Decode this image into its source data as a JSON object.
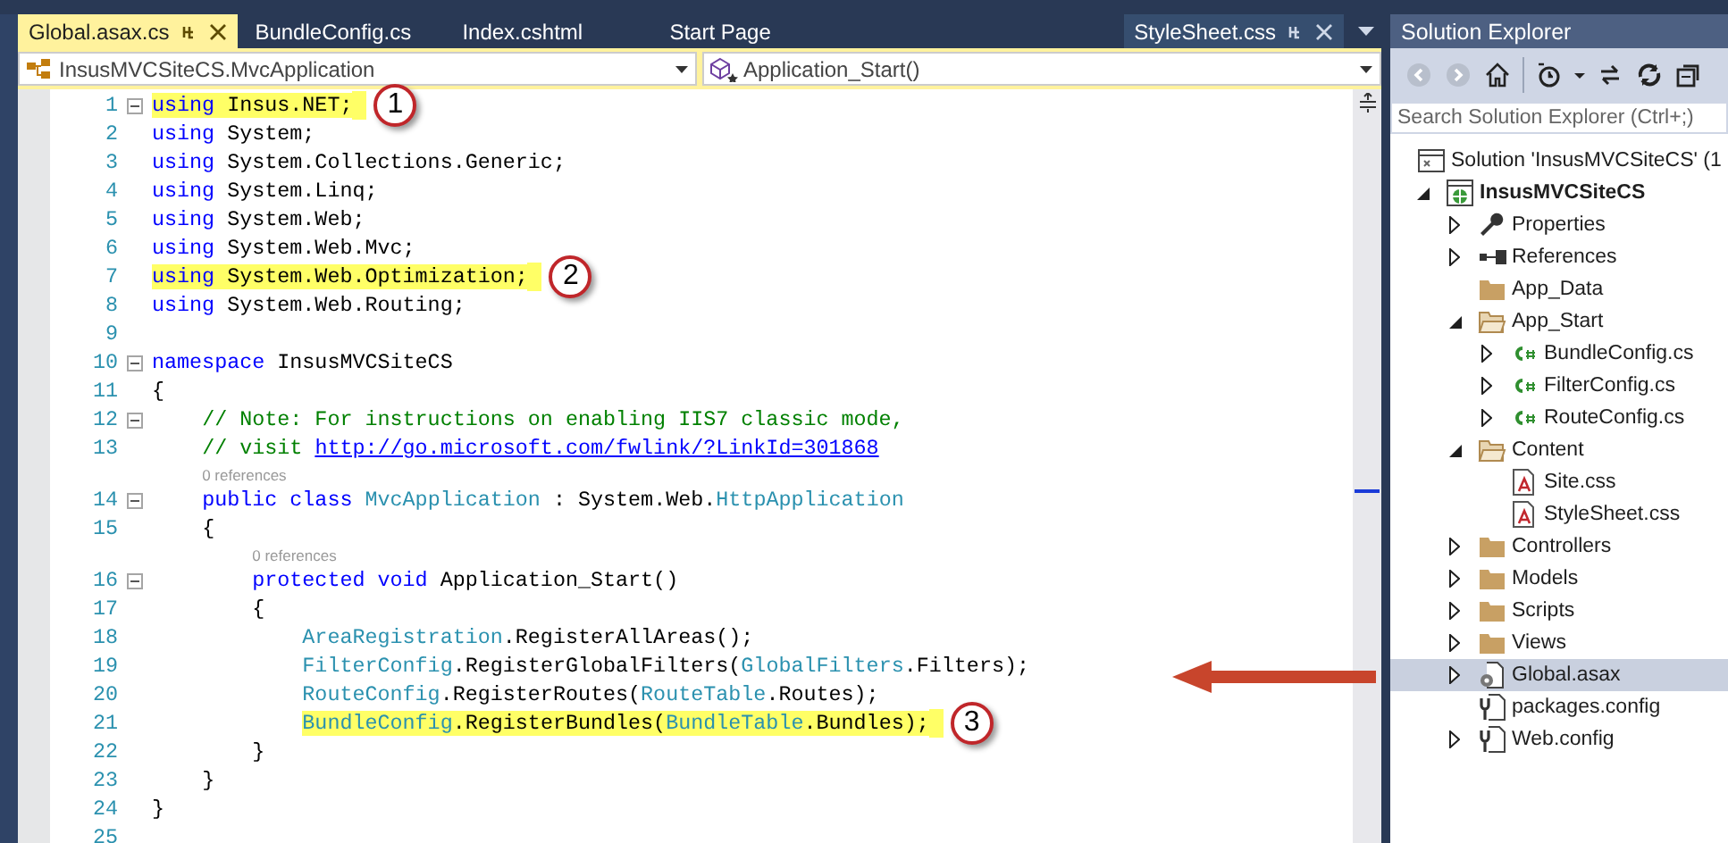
{
  "tabs": [
    {
      "label": "Global.asax.cs",
      "selected": true,
      "kind": "document"
    },
    {
      "label": "BundleConfig.cs",
      "selected": false,
      "kind": "document"
    },
    {
      "label": "Index.cshtml",
      "selected": false,
      "kind": "document"
    },
    {
      "label": "Start Page",
      "selected": false,
      "kind": "document"
    },
    {
      "label": "StyleSheet.css",
      "selected": false,
      "kind": "preview"
    }
  ],
  "navigation_bar": {
    "type_selector": "InsusMVCSiteCS.MvcApplication",
    "member_selector": "Application_Start()"
  },
  "code": {
    "lines": [
      {
        "kind": "code",
        "number": "1",
        "fold": true,
        "highlight": true,
        "callout": "1",
        "tokens": [
          {
            "kind": "kw",
            "text": "using"
          },
          {
            "kind": "plain",
            "text": " Insus.NET;"
          }
        ]
      },
      {
        "kind": "code",
        "number": "2",
        "fold": false,
        "highlight": false,
        "tokens": [
          {
            "kind": "kw",
            "text": "using"
          },
          {
            "kind": "plain",
            "text": " System;"
          }
        ]
      },
      {
        "kind": "code",
        "number": "3",
        "fold": false,
        "highlight": false,
        "tokens": [
          {
            "kind": "kw",
            "text": "using"
          },
          {
            "kind": "plain",
            "text": " System.Collections.Generic;"
          }
        ]
      },
      {
        "kind": "code",
        "number": "4",
        "fold": false,
        "highlight": false,
        "tokens": [
          {
            "kind": "kw",
            "text": "using"
          },
          {
            "kind": "plain",
            "text": " System.Linq;"
          }
        ]
      },
      {
        "kind": "code",
        "number": "5",
        "fold": false,
        "highlight": false,
        "tokens": [
          {
            "kind": "kw",
            "text": "using"
          },
          {
            "kind": "plain",
            "text": " System.Web;"
          }
        ]
      },
      {
        "kind": "code",
        "number": "6",
        "fold": false,
        "highlight": false,
        "tokens": [
          {
            "kind": "kw",
            "text": "using"
          },
          {
            "kind": "plain",
            "text": " System.Web.Mvc;"
          }
        ]
      },
      {
        "kind": "code",
        "number": "7",
        "fold": false,
        "highlight": true,
        "callout": "2",
        "tokens": [
          {
            "kind": "kw",
            "text": "using"
          },
          {
            "kind": "plain",
            "text": " System.Web.Optimization;"
          }
        ]
      },
      {
        "kind": "code",
        "number": "8",
        "fold": false,
        "highlight": false,
        "tokens": [
          {
            "kind": "kw",
            "text": "using"
          },
          {
            "kind": "plain",
            "text": " System.Web.Routing;"
          }
        ]
      },
      {
        "kind": "code",
        "number": "9",
        "fold": false
      },
      {
        "kind": "code",
        "number": "10",
        "fold": true,
        "highlight": false,
        "tokens": [
          {
            "kind": "kw",
            "text": "namespace"
          },
          {
            "kind": "plain",
            "text": " InsusMVCSiteCS"
          }
        ]
      },
      {
        "kind": "code",
        "number": "11",
        "fold": false,
        "highlight": false,
        "tokens": [
          {
            "kind": "plain",
            "text": "{"
          }
        ]
      },
      {
        "kind": "code",
        "number": "12",
        "fold": true,
        "highlight": false,
        "tokens": [
          {
            "kind": "comment",
            "text": "    // Note: For instructions on enabling IIS7 classic mode,"
          }
        ]
      },
      {
        "kind": "code",
        "number": "13",
        "fold": false,
        "highlight": false,
        "tokens": [
          {
            "kind": "comment",
            "text": "    // visit "
          },
          {
            "kind": "link",
            "text": "http://go.microsoft.com/fwlink/?LinkId=301868"
          }
        ]
      },
      {
        "kind": "codelens",
        "text": "0 references"
      },
      {
        "kind": "code",
        "number": "14",
        "fold": true,
        "highlight": false,
        "tokens": [
          {
            "kind": "kw",
            "text": "    public class "
          },
          {
            "kind": "type",
            "text": "MvcApplication"
          },
          {
            "kind": "plain",
            "text": " : System.Web."
          },
          {
            "kind": "type",
            "text": "HttpApplication"
          }
        ]
      },
      {
        "kind": "code",
        "number": "15",
        "fold": false,
        "highlight": false,
        "tokens": [
          {
            "kind": "plain",
            "text": "    {"
          }
        ]
      },
      {
        "kind": "codelens",
        "text": "0 references"
      },
      {
        "kind": "code",
        "number": "16",
        "fold": true,
        "highlight": false,
        "tokens": [
          {
            "kind": "kw",
            "text": "        protected void"
          },
          {
            "kind": "plain",
            "text": " Application_Start()"
          }
        ]
      },
      {
        "kind": "code",
        "number": "17",
        "fold": false,
        "highlight": false,
        "tokens": [
          {
            "kind": "plain",
            "text": "        {"
          }
        ]
      },
      {
        "kind": "code",
        "number": "18",
        "fold": false,
        "highlight": false,
        "tokens": [
          {
            "kind": "type",
            "text": "            AreaRegistration"
          },
          {
            "kind": "plain",
            "text": ".RegisterAllAreas();"
          }
        ]
      },
      {
        "kind": "code",
        "number": "19",
        "fold": false,
        "highlight": false,
        "tokens": [
          {
            "kind": "type",
            "text": "            FilterConfig"
          },
          {
            "kind": "plain",
            "text": ".RegisterGlobalFilters("
          },
          {
            "kind": "type",
            "text": "GlobalFilters"
          },
          {
            "kind": "plain",
            "text": ".Filters);"
          }
        ]
      },
      {
        "kind": "code",
        "number": "20",
        "fold": false,
        "highlight": false,
        "tokens": [
          {
            "kind": "type",
            "text": "            RouteConfig"
          },
          {
            "kind": "plain",
            "text": ".RegisterRoutes("
          },
          {
            "kind": "type",
            "text": "RouteTable"
          },
          {
            "kind": "plain",
            "text": ".Routes);"
          }
        ]
      },
      {
        "kind": "code",
        "number": "21",
        "fold": false,
        "highlight": true,
        "callout": "3",
        "tokens": [
          {
            "kind": "type",
            "text": "            BundleConfig"
          },
          {
            "kind": "plain",
            "text": ".RegisterBundles("
          },
          {
            "kind": "type",
            "text": "BundleTable"
          },
          {
            "kind": "plain",
            "text": ".Bundles);"
          }
        ]
      },
      {
        "kind": "code",
        "number": "22",
        "fold": false,
        "highlight": false,
        "tokens": [
          {
            "kind": "plain",
            "text": "        }"
          }
        ]
      },
      {
        "kind": "code",
        "number": "23",
        "fold": false,
        "highlight": false,
        "tokens": [
          {
            "kind": "plain",
            "text": "    }"
          }
        ]
      },
      {
        "kind": "code",
        "number": "24",
        "fold": false,
        "highlight": false,
        "tokens": [
          {
            "kind": "plain",
            "text": "}"
          }
        ]
      },
      {
        "kind": "code",
        "number": "25",
        "fold": false
      }
    ]
  },
  "solution_explorer": {
    "title": "Solution Explorer",
    "search": {
      "placeholder": "Search Solution Explorer (Ctrl+;)"
    },
    "tree": [
      {
        "label": "Solution 'InsusMVCSiteCS' (1",
        "kind": "solution",
        "selected": false,
        "children": [
          {
            "label": "InsusMVCSiteCS",
            "kind": "project",
            "expanded": true,
            "selected": false,
            "children": [
              {
                "label": "Properties",
                "kind": "properties",
                "expanded": false,
                "selected": false
              },
              {
                "label": "References",
                "kind": "references",
                "expanded": false,
                "selected": false
              },
              {
                "label": "App_Data",
                "kind": "folder",
                "selected": false
              },
              {
                "label": "App_Start",
                "kind": "folder",
                "expanded": true,
                "selected": false,
                "children": [
                  {
                    "label": "BundleConfig.cs",
                    "kind": "csharp",
                    "expanded": false,
                    "selected": false
                  },
                  {
                    "label": "FilterConfig.cs",
                    "kind": "csharp",
                    "expanded": false,
                    "selected": false
                  },
                  {
                    "label": "RouteConfig.cs",
                    "kind": "csharp",
                    "expanded": false,
                    "selected": false
                  }
                ]
              },
              {
                "label": "Content",
                "kind": "folder",
                "expanded": true,
                "selected": false,
                "children": [
                  {
                    "label": "Site.css",
                    "kind": "css",
                    "selected": false
                  },
                  {
                    "label": "StyleSheet.css",
                    "kind": "css",
                    "selected": false
                  }
                ]
              },
              {
                "label": "Controllers",
                "kind": "folder",
                "expanded": false,
                "selected": false
              },
              {
                "label": "Models",
                "kind": "folder",
                "expanded": false,
                "selected": false
              },
              {
                "label": "Scripts",
                "kind": "folder",
                "expanded": false,
                "selected": false
              },
              {
                "label": "Views",
                "kind": "folder",
                "expanded": false,
                "selected": false
              },
              {
                "label": "Global.asax",
                "kind": "global",
                "expanded": false,
                "selected": true
              },
              {
                "label": "packages.config",
                "kind": "config",
                "selected": false
              },
              {
                "label": "Web.config",
                "kind": "config",
                "expanded": false,
                "selected": false
              }
            ]
          }
        ]
      }
    ]
  }
}
